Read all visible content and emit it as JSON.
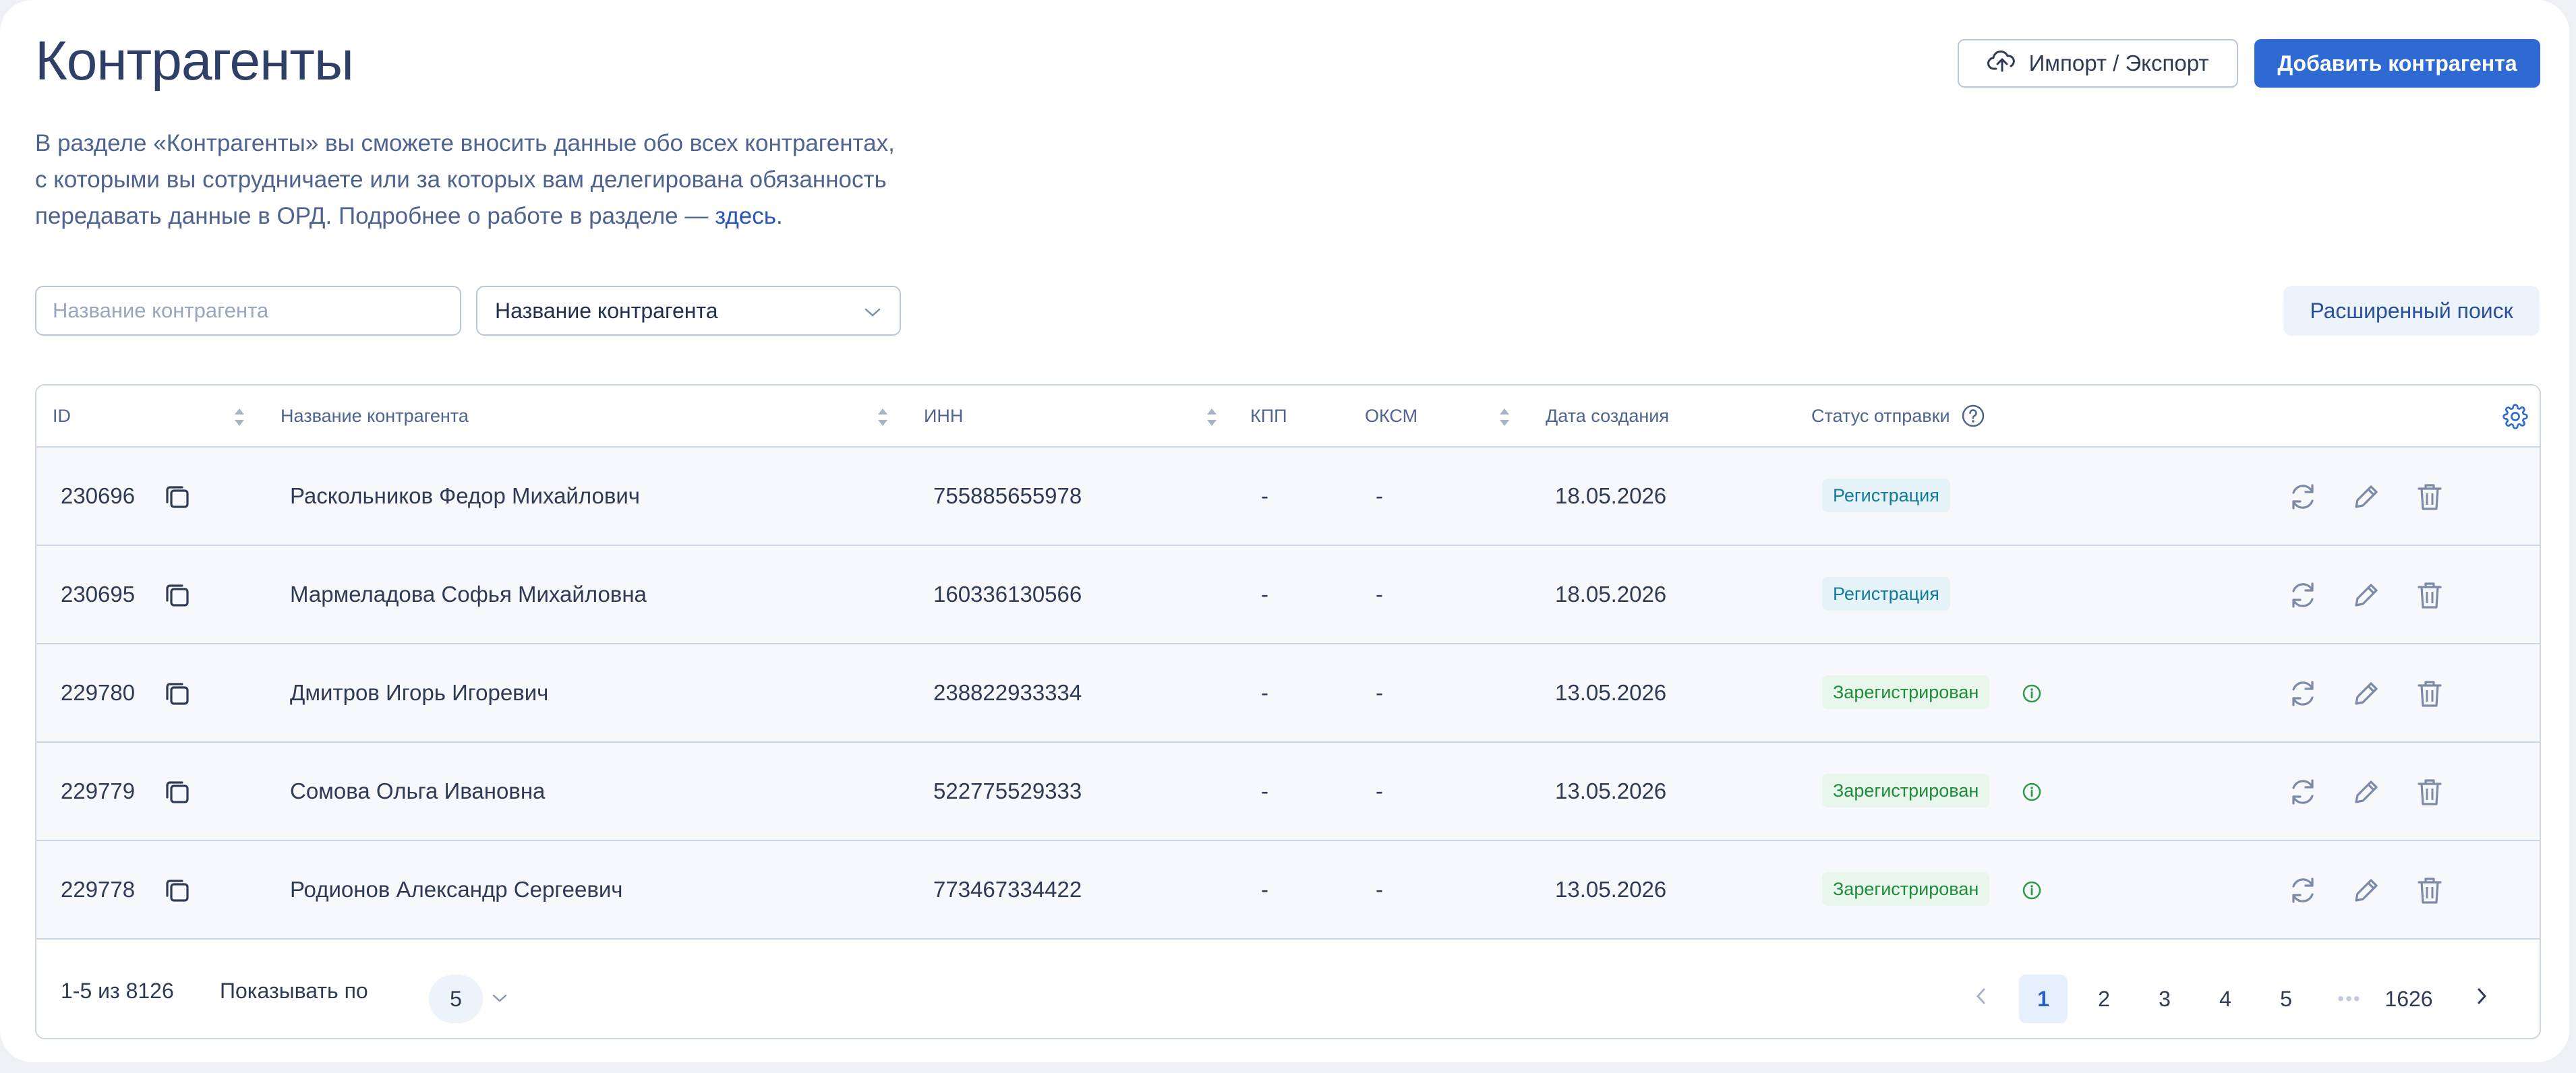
{
  "page": {
    "title": "Контрагенты",
    "description": {
      "line1": "В разделе «Контрагенты» вы сможете вносить данные обо всех контрагентах,",
      "line2": "с которыми вы сотрудничаете или за которых вам делегирована обязанность",
      "line3_prefix": "передавать данные в ОРД. Подробнее о работе в разделе — ",
      "link": "здесь."
    }
  },
  "toolbar": {
    "import_export_label": "Импорт / Экспорт",
    "add_label": "Добавить контрагента"
  },
  "filters": {
    "search_placeholder": "Название контрагента",
    "search_value": "",
    "select_value": "Название контрагента",
    "advanced_search_label": "Расширенный поиск"
  },
  "table": {
    "columns": {
      "id": "ID",
      "name": "Название контрагента",
      "inn": "ИНН",
      "kpp": "КПП",
      "oksm": "ОКСМ",
      "created": "Дата создания",
      "status": "Статус отправки"
    },
    "rows": [
      {
        "id": "230696",
        "name": "Раскольников Федор Михайлович",
        "inn": "755885655978",
        "kpp": "-",
        "oksm": "-",
        "created": "18.05.2026",
        "status": "Регистрация",
        "status_kind": "registration"
      },
      {
        "id": "230695",
        "name": "Мармеладова Софья Михайловна",
        "inn": "160336130566",
        "kpp": "-",
        "oksm": "-",
        "created": "18.05.2026",
        "status": "Регистрация",
        "status_kind": "registration"
      },
      {
        "id": "229780",
        "name": "Дмитров Игорь Игоревич",
        "inn": "238822933334",
        "kpp": "-",
        "oksm": "-",
        "created": "13.05.2026",
        "status": "Зарегистрирован",
        "status_kind": "registered"
      },
      {
        "id": "229779",
        "name": "Сомова Ольга Ивановна",
        "inn": "522775529333",
        "kpp": "-",
        "oksm": "-",
        "created": "13.05.2026",
        "status": "Зарегистрирован",
        "status_kind": "registered"
      },
      {
        "id": "229778",
        "name": "Родионов Александр Сергеевич",
        "inn": "773467334422",
        "kpp": "-",
        "oksm": "-",
        "created": "13.05.2026",
        "status": "Зарегистрирован",
        "status_kind": "registered"
      }
    ]
  },
  "pagination": {
    "range_label": "1-5 из 8126",
    "per_page_label": "Показывать по",
    "per_page_value": "5",
    "pages": [
      "1",
      "2",
      "3",
      "4",
      "5"
    ],
    "current_page": "1",
    "ellipsis": "•••",
    "last_page": "1626"
  },
  "colors": {
    "primary": "#2f6ad3",
    "text": "#2f3b55",
    "muted": "#4f6390",
    "registration_badge": "#e5f3f8",
    "registered_badge": "#e9f6ec"
  },
  "icons": [
    "upload-cloud-icon",
    "chevron-down-icon",
    "sort-icon",
    "help-icon",
    "settings-gear-icon",
    "copy-icon",
    "refresh-icon",
    "edit-pencil-icon",
    "trash-icon",
    "info-icon",
    "chevron-left-icon",
    "chevron-right-icon"
  ]
}
